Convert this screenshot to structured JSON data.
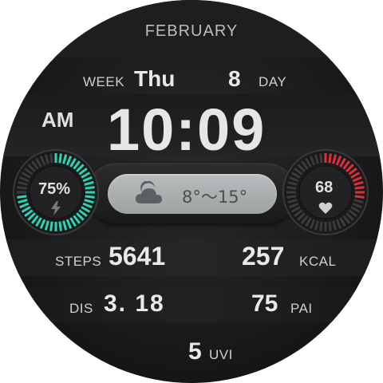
{
  "date": {
    "month": "FEBRUARY",
    "week_label": "WEEK",
    "weekday": "Thu",
    "day_number": "8",
    "day_label": "DAY"
  },
  "time": {
    "period": "AM",
    "value": "10:09"
  },
  "battery": {
    "percent_text": "75%",
    "level": 0.75,
    "color": "#2fd3b4",
    "icon": "lightning-bolt-icon"
  },
  "weather": {
    "range_text": "8°～15°",
    "icon": "cloudy-night-icon",
    "pill_color": "#aeb2b3"
  },
  "heart_rate": {
    "value": "68",
    "level": 0.3,
    "color": "#d8313c",
    "icon": "heart-icon"
  },
  "stats": {
    "steps_label": "STEPS",
    "steps_value": "5641",
    "kcal_value": "257",
    "kcal_label": "KCAL",
    "dis_label": "DIS",
    "dis_value": "3. 18",
    "pai_value": "75",
    "pai_label": "PAI",
    "uvi_value": "5",
    "uvi_label": "UVI"
  }
}
